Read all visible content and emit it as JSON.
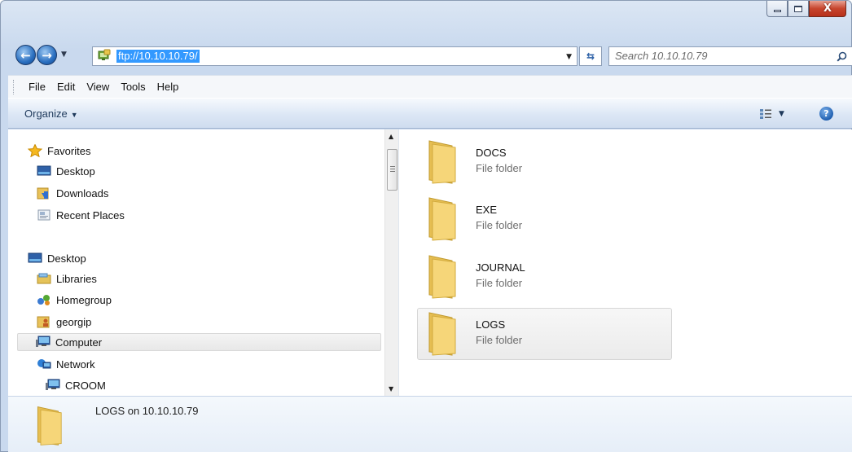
{
  "window": {
    "caption_buttons": {
      "minimize": "–",
      "maximize": "□",
      "close": "X"
    }
  },
  "nav": {
    "address": "ftp://10.10.10.79/",
    "search_placeholder": "Search 10.10.10.79",
    "icons": {
      "back": "back-arrow-icon",
      "forward": "forward-arrow-icon",
      "refresh": "refresh-icon",
      "search": "magnifier-icon"
    }
  },
  "menu": {
    "items": [
      "File",
      "Edit",
      "View",
      "Tools",
      "Help"
    ]
  },
  "toolbar": {
    "organize_label": "Organize",
    "help_label": "?"
  },
  "sidebar": {
    "items": [
      {
        "label": "Favorites",
        "icon": "star-icon"
      },
      {
        "label": "Desktop",
        "icon": "desktop-icon"
      },
      {
        "label": "Downloads",
        "icon": "downloads-icon"
      },
      {
        "label": "Recent Places",
        "icon": "recent-places-icon"
      },
      {
        "label": "Desktop",
        "icon": "desktop-icon"
      },
      {
        "label": "Libraries",
        "icon": "libraries-icon"
      },
      {
        "label": "Homegroup",
        "icon": "homegroup-icon"
      },
      {
        "label": "georgip",
        "icon": "user-folder-icon"
      },
      {
        "label": "Computer",
        "icon": "computer-icon",
        "selected": true
      },
      {
        "label": "Network",
        "icon": "network-icon"
      },
      {
        "label": "CROOM",
        "icon": "computer-icon"
      }
    ]
  },
  "files": [
    {
      "name": "DOCS",
      "type": "File folder"
    },
    {
      "name": "EXE",
      "type": "File folder"
    },
    {
      "name": "JOURNAL",
      "type": "File folder"
    },
    {
      "name": "LOGS",
      "type": "File folder",
      "selected": true
    }
  ],
  "details": {
    "title": "LOGS on 10.10.10.79"
  },
  "colors": {
    "selection_blue": "#3399ff",
    "chrome": "#dce7f5",
    "folder": "#f2cf6a"
  }
}
